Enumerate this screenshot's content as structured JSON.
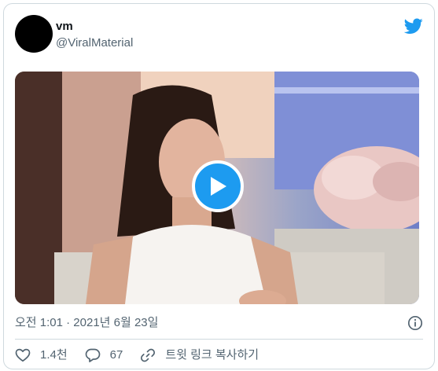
{
  "author": {
    "display_name": "vm",
    "handle": "@ViralMaterial"
  },
  "brand_color": "#1d9bf0",
  "icons": {
    "brand": "twitter-bird-icon",
    "play": "play-icon",
    "info": "info-icon",
    "like": "heart-icon",
    "reply": "speech-bubble-icon",
    "share": "link-icon"
  },
  "tweet": {
    "timestamp": "오전 1:01 · 2021년 6월 23일"
  },
  "actions": {
    "likes": "1.4천",
    "replies": "67",
    "copy_link": "트윗 링크 복사하기"
  }
}
